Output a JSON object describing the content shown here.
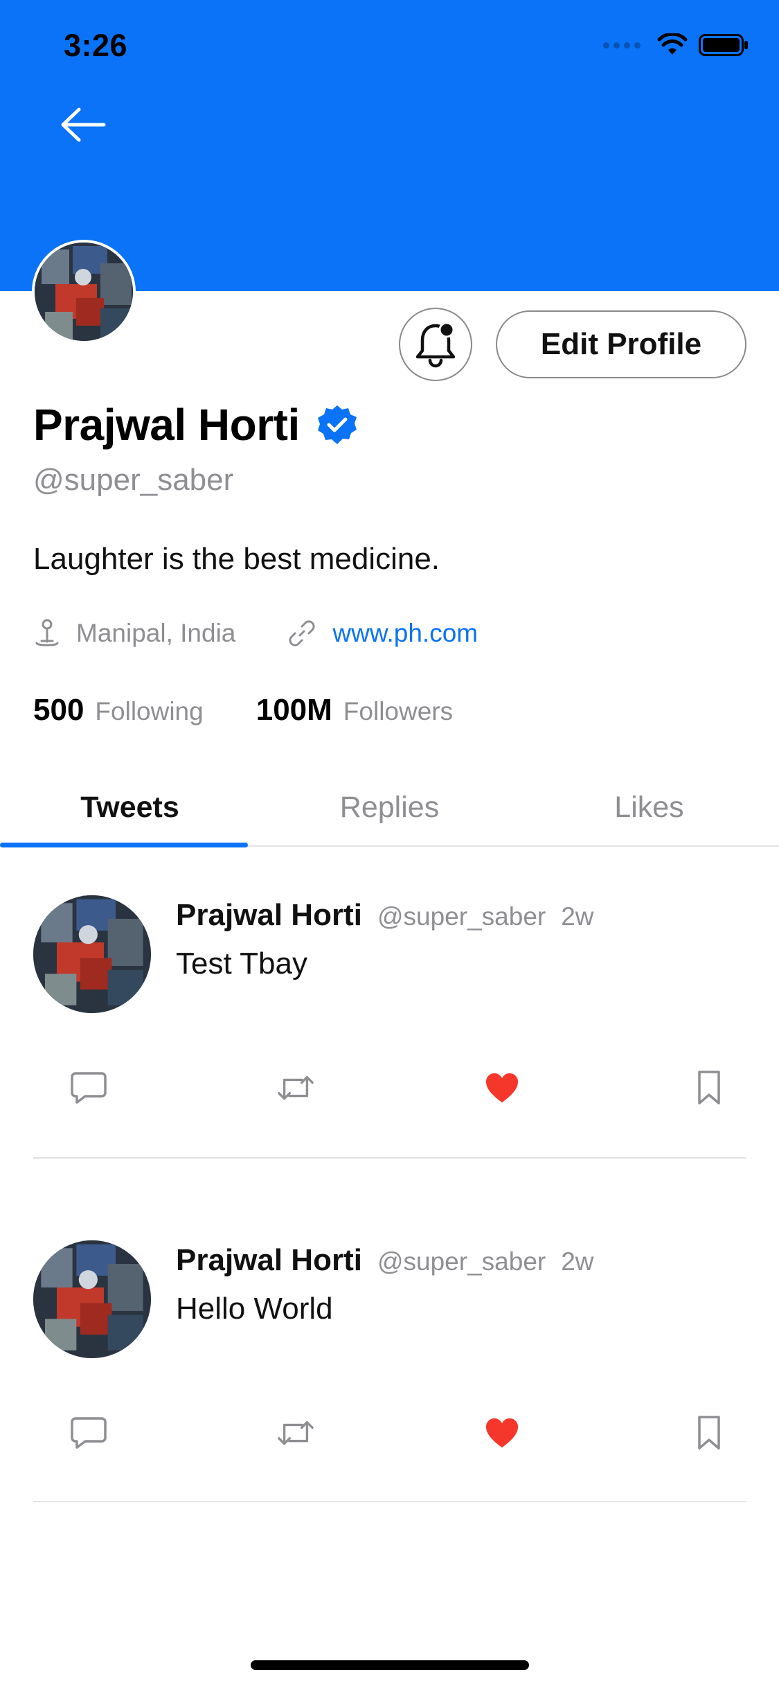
{
  "status_bar": {
    "time": "3:26"
  },
  "profile": {
    "name": "Prajwal Horti",
    "handle": "@super_saber",
    "bio": "Laughter is the best medicine.",
    "location": "Manipal, India",
    "website": "www.ph.com",
    "following_count": "500",
    "following_label": "Following",
    "followers_count": "100M",
    "followers_label": "Followers",
    "edit_label": "Edit Profile",
    "verified": true
  },
  "tabs": [
    {
      "label": "Tweets",
      "active": true
    },
    {
      "label": "Replies",
      "active": false
    },
    {
      "label": "Likes",
      "active": false
    }
  ],
  "tweets": [
    {
      "name": "Prajwal Horti",
      "handle": "@super_saber",
      "time": "2w",
      "text": "Test Tbay",
      "liked": true
    },
    {
      "name": "Prajwal Horti",
      "handle": "@super_saber",
      "time": "2w",
      "text": "Hello World",
      "liked": true
    }
  ],
  "colors": {
    "accent": "#0a73f7",
    "like": "#f5362b",
    "secondary_text": "#8e8e93"
  },
  "icons": {
    "back": "arrow-left-icon",
    "bell": "bell-icon",
    "verified": "verified-badge-icon",
    "location": "location-pin-icon",
    "link": "link-icon",
    "reply": "comment-icon",
    "retweet": "retweet-icon",
    "like": "heart-icon",
    "bookmark": "bookmark-icon"
  }
}
